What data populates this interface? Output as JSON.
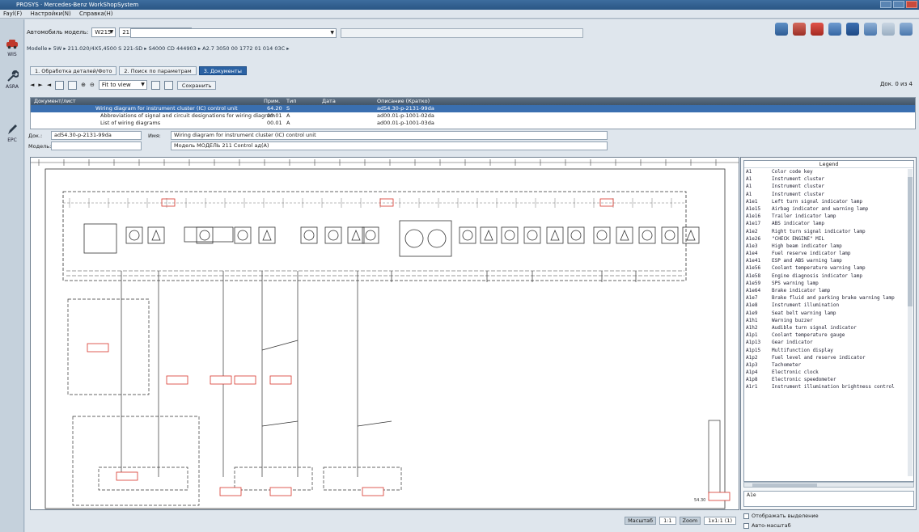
{
  "window": {
    "title": "PROSYS · Mercedes-Benz WorkShopSystem"
  },
  "menubar": [
    "Fayl(F)",
    "Настройки(N)",
    "Справка(H)"
  ],
  "sidebar": [
    {
      "label": "WIS",
      "icon": "car-icon",
      "color": "#c0392b"
    },
    {
      "label": "ASRA",
      "icon": "wrench-icon",
      "color": "#345"
    },
    {
      "label": "EPC",
      "icon": "pen-icon",
      "color": "#345"
    }
  ],
  "vehicle": {
    "label": "Автомобиль модель:",
    "series": "W215",
    "model": "211.020 ИЗ 168",
    "breadcrumb": "Modelle ▸ 5W ▸ 211.020/4X5,4500 S 221-SD ▸ S4000 CD 444903 ▸ A2.7 3050 00 1772 01 014 03C ▸"
  },
  "tabs": [
    {
      "label": "1. Обработка деталей/Фото",
      "active": false
    },
    {
      "label": "2. Поиск по параметрам",
      "active": false
    },
    {
      "label": "3. Документы",
      "active": true
    }
  ],
  "toolbar": {
    "zoom_value": "Fit to view",
    "action_label": "Сохранить",
    "page_count": "Док. 0 из 4"
  },
  "doclist": {
    "headers": [
      "Документ/лист",
      "Прим.",
      "Тип",
      "Дата",
      "Описание (Кратко)"
    ],
    "rows": [
      {
        "title": "Wiring diagram for instrument cluster (IC) control unit",
        "code": "64.20",
        "type": "S",
        "date": "",
        "desc": "ad54.30-p-2131-99da",
        "selected": true
      },
      {
        "title": "Abbreviations of signal and circuit designations for wiring diagram",
        "code": "00.01",
        "type": "A",
        "date": "",
        "desc": "ad00.01-p-1001-02da",
        "selected": false
      },
      {
        "title": "List of wiring diagrams",
        "code": "00.01",
        "type": "A",
        "date": "",
        "desc": "ad00.01-p-1001-03da",
        "selected": false
      }
    ]
  },
  "meta": {
    "doc_label": "Док.:",
    "doc_value": "ad54.30-p-2131-99da",
    "title_label": "Имя:",
    "title_value": "Wiring diagram for instrument cluster (IC) control unit",
    "model_label": "Модель:",
    "model_value": "Модель МОДЕЛЬ 211 Control ад(А)"
  },
  "diagram": {
    "components": [
      "A1e1",
      "A1e3",
      "A1e4",
      "A1e5",
      "A1e6",
      "A1e7",
      "A1e9",
      "A1e10",
      "A1e11",
      "A1e13",
      "A1e15",
      "A1e16"
    ],
    "boxes": [
      {
        "label": "X11/4"
      },
      {
        "label": "W10"
      },
      {
        "label": "Z7/5"
      },
      {
        "label": "Z7/36"
      },
      {
        "label": "Z3/10"
      },
      {
        "label": "Z3/11"
      },
      {
        "label": "N73"
      },
      {
        "label": "X4/10"
      },
      {
        "label": "X4/20"
      }
    ],
    "page_ref": "54.30"
  },
  "legend": {
    "title": "Legend",
    "items": [
      {
        "code": "A1",
        "desc": "Color code key"
      },
      {
        "code": "A1",
        "desc": "Instrument cluster"
      },
      {
        "code": "A1",
        "desc": "Instrument cluster"
      },
      {
        "code": "A1",
        "desc": "Instrument cluster"
      },
      {
        "code": "A1e1",
        "desc": "Left turn signal indicator lamp"
      },
      {
        "code": "A1e15",
        "desc": "Airbag indicator and warning lamp"
      },
      {
        "code": "A1e16",
        "desc": "Trailer indicator lamp"
      },
      {
        "code": "A1e17",
        "desc": "ABS indicator lamp"
      },
      {
        "code": "A1e2",
        "desc": "Right turn signal indicator lamp"
      },
      {
        "code": "A1e26",
        "desc": "\"CHECK ENGINE\" MIL"
      },
      {
        "code": "A1e3",
        "desc": "High beam indicator lamp"
      },
      {
        "code": "A1e4",
        "desc": "Fuel reserve indicator lamp"
      },
      {
        "code": "A1e41",
        "desc": "ESP and ABS warning lamp"
      },
      {
        "code": "A1e56",
        "desc": "Coolant temperature warning lamp"
      },
      {
        "code": "A1e58",
        "desc": "Engine diagnosis indicator lamp"
      },
      {
        "code": "A1e59",
        "desc": "SPS warning lamp"
      },
      {
        "code": "A1e64",
        "desc": "Brake indicator lamp"
      },
      {
        "code": "A1e7",
        "desc": "Brake fluid and parking brake warning lamp"
      },
      {
        "code": "A1e8",
        "desc": "Instrument illumination"
      },
      {
        "code": "A1e9",
        "desc": "Seat belt warning lamp"
      },
      {
        "code": "A1h1",
        "desc": "Warning buzzer"
      },
      {
        "code": "A1h2",
        "desc": "Audible turn signal indicator"
      },
      {
        "code": "A1p1",
        "desc": "Coolant temperature gauge"
      },
      {
        "code": "A1p13",
        "desc": "Gear indicator"
      },
      {
        "code": "A1p15",
        "desc": "Multifunction display"
      },
      {
        "code": "A1p2",
        "desc": "Fuel level and reserve indicator"
      },
      {
        "code": "A1p3",
        "desc": "Tachometer"
      },
      {
        "code": "A1p4",
        "desc": "Electronic clock"
      },
      {
        "code": "A1p8",
        "desc": "Electronic speedometer"
      },
      {
        "code": "A1r1",
        "desc": "Instrument illumination brightness control"
      }
    ],
    "field_text": "A1e"
  },
  "side_options": {
    "opt1": "Отображать выделение",
    "opt2": "Авто-масштаб"
  },
  "statusbar": {
    "scale_label": "Масштаб",
    "scale_value": "1:1",
    "zoom_label": "Zoom",
    "zoom_value": "1x1:1 (1)",
    "stamp": "Продукт"
  },
  "colors": {
    "accent": "#2b62a3",
    "selection": "#3a6fb0",
    "diagram_red": "#d8362b"
  }
}
